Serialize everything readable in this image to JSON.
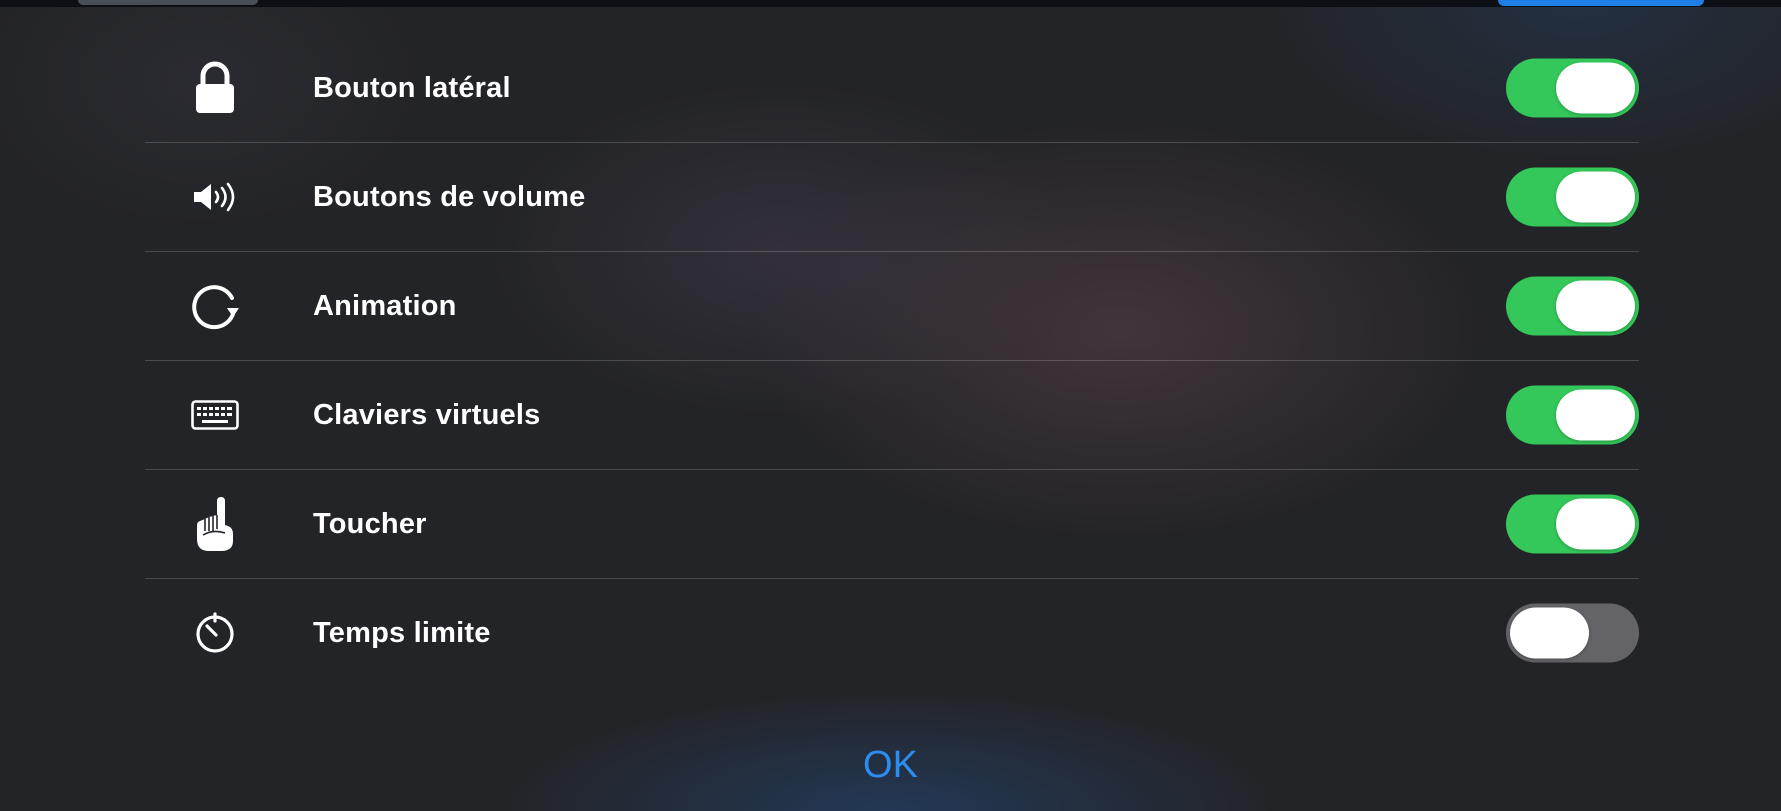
{
  "colors": {
    "toggle_on": "#34c759",
    "toggle_off": "#646468",
    "accent_blue": "#2d8cf0"
  },
  "settings": [
    {
      "label": "Bouton latéral",
      "icon": "lock-icon",
      "enabled": true
    },
    {
      "label": "Boutons de volume",
      "icon": "speaker-volume-icon",
      "enabled": true
    },
    {
      "label": "Animation",
      "icon": "rotate-icon",
      "enabled": true
    },
    {
      "label": "Claviers virtuels",
      "icon": "keyboard-icon",
      "enabled": true
    },
    {
      "label": "Toucher",
      "icon": "pointing-hand-icon",
      "enabled": true
    },
    {
      "label": "Temps limite",
      "icon": "timer-icon",
      "enabled": false
    }
  ],
  "ok_label": "OK"
}
